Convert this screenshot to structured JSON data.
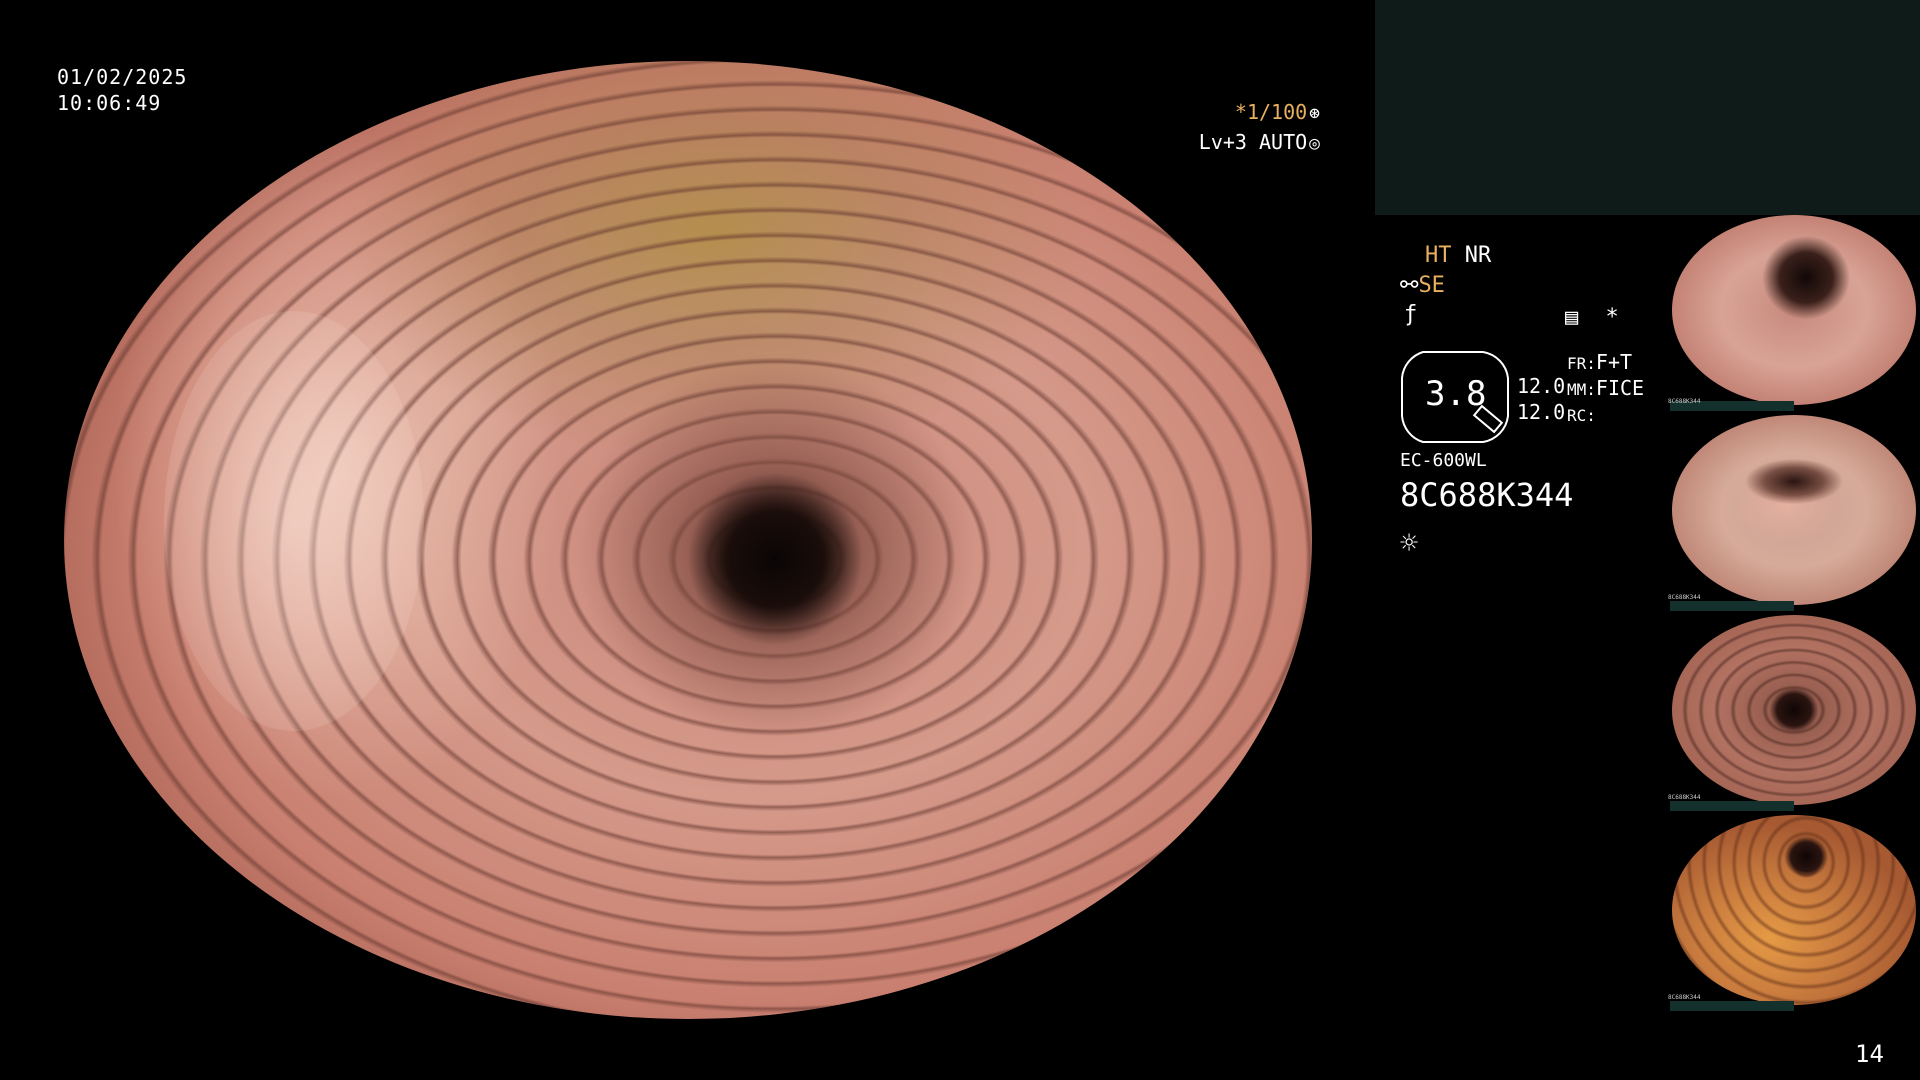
{
  "overlay": {
    "date": "01/02/2025",
    "time": "10:06:49",
    "shutter": "*1/100",
    "shutter_icon": "aperture-icon",
    "level": "Lv+3 AUTO",
    "level_icon": "target-icon",
    "frame_number": "14"
  },
  "info_panel": {
    "ht": "HT",
    "nr": "NR",
    "se": "SE",
    "se_icon": "pencil-icon",
    "f_icon": "curve-icon",
    "menu_icon": "list-box-icon",
    "asterisk": "*",
    "zoom_value": "3.8",
    "param1": "12.0",
    "param2": "12.0",
    "fr_label": "FR:",
    "fr_value": "F+T",
    "mm_label": "MM:",
    "mm_value": "FICE",
    "rc_label": "RC:",
    "rc_value": "",
    "scope_model": "EC-600WL",
    "serial": "8C688K344",
    "light_icon": "sun-icon"
  },
  "thumbnails": [
    {
      "serial": "8C688K344"
    },
    {
      "serial": "8C688K344"
    },
    {
      "serial": "8C688K344"
    },
    {
      "serial": "8C688K344"
    }
  ],
  "colors": {
    "accent_orange": "#e8b060",
    "panel_teal": "#0f1b19",
    "background": "#000000"
  }
}
